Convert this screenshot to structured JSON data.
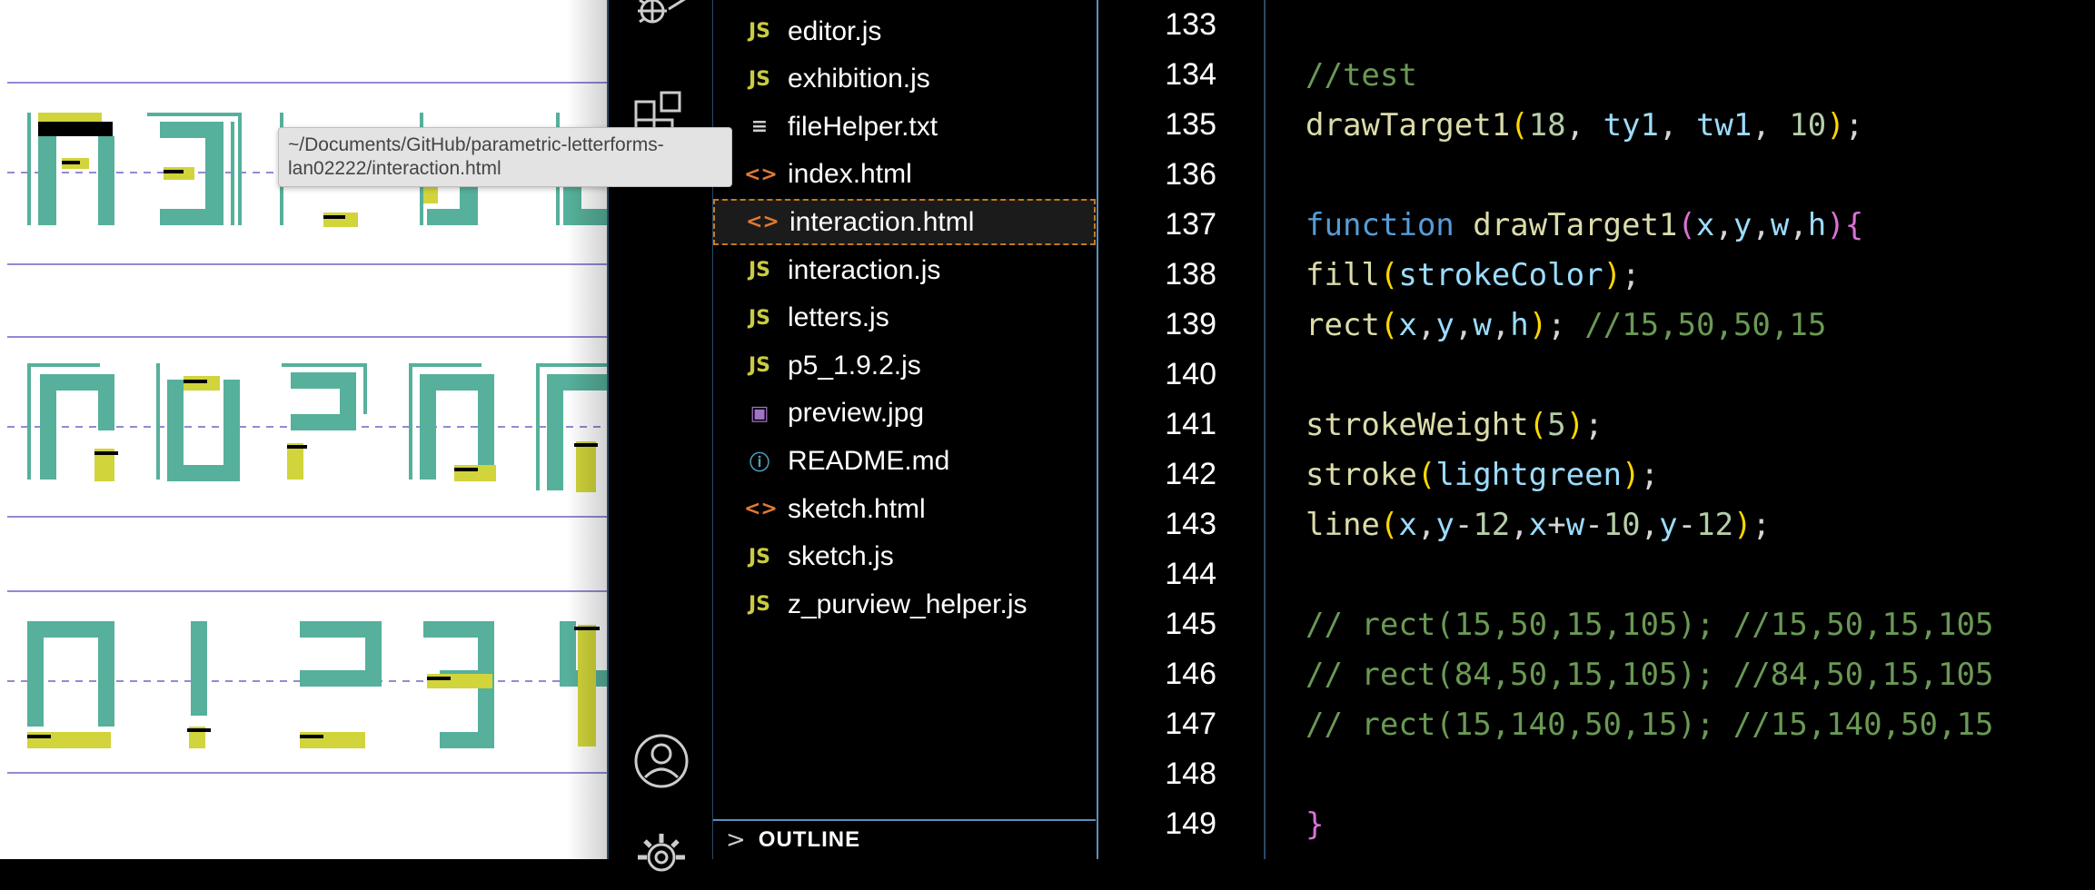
{
  "tooltip": {
    "line1": "~/Documents/GitHub/parametric-letterforms-",
    "line2": "lan02222/interaction.html"
  },
  "activity_bar": {
    "icons": [
      "debug-icon",
      "extensions-icon",
      "account-icon",
      "settings-gear-icon"
    ]
  },
  "explorer": {
    "files": [
      {
        "name": "editor.js",
        "type": "js",
        "icon": "JS"
      },
      {
        "name": "exhibition.js",
        "type": "js",
        "icon": "JS"
      },
      {
        "name": "fileHelper.txt",
        "type": "txt",
        "icon": "≡"
      },
      {
        "name": "index.html",
        "type": "html",
        "icon": "<>"
      },
      {
        "name": "interaction.html",
        "type": "html",
        "icon": "<>",
        "selected": true
      },
      {
        "name": "interaction.js",
        "type": "js",
        "icon": "JS"
      },
      {
        "name": "letters.js",
        "type": "js",
        "icon": "JS"
      },
      {
        "name": "p5_1.9.2.js",
        "type": "js",
        "icon": "JS"
      },
      {
        "name": "preview.jpg",
        "type": "img",
        "icon": "▣"
      },
      {
        "name": "README.md",
        "type": "md",
        "icon": "ⓘ"
      },
      {
        "name": "sketch.html",
        "type": "html",
        "icon": "<>"
      },
      {
        "name": "sketch.js",
        "type": "js",
        "icon": "JS"
      },
      {
        "name": "z_purview_helper.js",
        "type": "js",
        "icon": "JS"
      }
    ],
    "outline_label": "OUTLINE",
    "outline_chevron": ">"
  },
  "gutter": {
    "line_numbers": [
      "133",
      "134",
      "135",
      "136",
      "137",
      "138",
      "139",
      "140",
      "141",
      "142",
      "143",
      "144",
      "145",
      "146",
      "147",
      "148",
      "149"
    ]
  },
  "code": {
    "lines": [
      [],
      [
        {
          "t": "//test",
          "c": "comment"
        }
      ],
      [
        {
          "t": "drawTarget1",
          "c": "func"
        },
        {
          "t": "(",
          "c": "paren2"
        },
        {
          "t": "18",
          "c": "num"
        },
        {
          "t": ", ",
          "c": "plain"
        },
        {
          "t": "ty1",
          "c": "var"
        },
        {
          "t": ", ",
          "c": "plain"
        },
        {
          "t": "tw1",
          "c": "var"
        },
        {
          "t": ", ",
          "c": "plain"
        },
        {
          "t": "10",
          "c": "num"
        },
        {
          "t": ")",
          "c": "paren2"
        },
        {
          "t": ";",
          "c": "plain"
        }
      ],
      [],
      [
        {
          "t": "function ",
          "c": "kw"
        },
        {
          "t": "drawTarget1",
          "c": "func"
        },
        {
          "t": "(",
          "c": "paren"
        },
        {
          "t": "x",
          "c": "var"
        },
        {
          "t": ",",
          "c": "plain"
        },
        {
          "t": "y",
          "c": "var"
        },
        {
          "t": ",",
          "c": "plain"
        },
        {
          "t": "w",
          "c": "var"
        },
        {
          "t": ",",
          "c": "plain"
        },
        {
          "t": "h",
          "c": "var"
        },
        {
          "t": ")",
          "c": "paren"
        },
        {
          "t": "{",
          "c": "paren"
        }
      ],
      [
        {
          "t": "fill",
          "c": "func"
        },
        {
          "t": "(",
          "c": "paren2"
        },
        {
          "t": "strokeColor",
          "c": "var"
        },
        {
          "t": ")",
          "c": "paren2"
        },
        {
          "t": ";",
          "c": "plain"
        }
      ],
      [
        {
          "t": "rect",
          "c": "func"
        },
        {
          "t": "(",
          "c": "paren2"
        },
        {
          "t": "x",
          "c": "var"
        },
        {
          "t": ",",
          "c": "plain"
        },
        {
          "t": "y",
          "c": "var"
        },
        {
          "t": ",",
          "c": "plain"
        },
        {
          "t": "w",
          "c": "var"
        },
        {
          "t": ",",
          "c": "plain"
        },
        {
          "t": "h",
          "c": "var"
        },
        {
          "t": ")",
          "c": "paren2"
        },
        {
          "t": "; ",
          "c": "plain"
        },
        {
          "t": "//15,50,50,15",
          "c": "comment"
        }
      ],
      [],
      [
        {
          "t": "strokeWeight",
          "c": "func"
        },
        {
          "t": "(",
          "c": "paren2"
        },
        {
          "t": "5",
          "c": "num"
        },
        {
          "t": ")",
          "c": "paren2"
        },
        {
          "t": ";",
          "c": "plain"
        }
      ],
      [
        {
          "t": "stroke",
          "c": "func"
        },
        {
          "t": "(",
          "c": "paren2"
        },
        {
          "t": "lightgreen",
          "c": "var"
        },
        {
          "t": ")",
          "c": "paren2"
        },
        {
          "t": ";",
          "c": "plain"
        }
      ],
      [
        {
          "t": "line",
          "c": "func"
        },
        {
          "t": "(",
          "c": "paren2"
        },
        {
          "t": "x",
          "c": "var"
        },
        {
          "t": ",",
          "c": "plain"
        },
        {
          "t": "y",
          "c": "var"
        },
        {
          "t": "-",
          "c": "plain"
        },
        {
          "t": "12",
          "c": "num"
        },
        {
          "t": ",",
          "c": "plain"
        },
        {
          "t": "x",
          "c": "var"
        },
        {
          "t": "+",
          "c": "plain"
        },
        {
          "t": "w",
          "c": "var"
        },
        {
          "t": "-",
          "c": "plain"
        },
        {
          "t": "10",
          "c": "num"
        },
        {
          "t": ",",
          "c": "plain"
        },
        {
          "t": "y",
          "c": "var"
        },
        {
          "t": "-",
          "c": "plain"
        },
        {
          "t": "12",
          "c": "num"
        },
        {
          "t": ")",
          "c": "paren2"
        },
        {
          "t": ";",
          "c": "plain"
        }
      ],
      [],
      [
        {
          "t": "// rect(15,50,15,105); //15,50,15,105",
          "c": "comment"
        }
      ],
      [
        {
          "t": "// rect(84,50,15,105); //84,50,15,105",
          "c": "comment"
        }
      ],
      [
        {
          "t": "// rect(15,140,50,15); //15,140,50,15",
          "c": "comment"
        }
      ],
      [],
      [
        {
          "t": "}",
          "c": "paren"
        }
      ]
    ]
  },
  "colors": {
    "teal": "#56b09b",
    "yellow": "#d1d43a",
    "guide_line": "#6b63c9",
    "selection_border": "#c47a1e",
    "panel_border": "#5a8fba"
  }
}
